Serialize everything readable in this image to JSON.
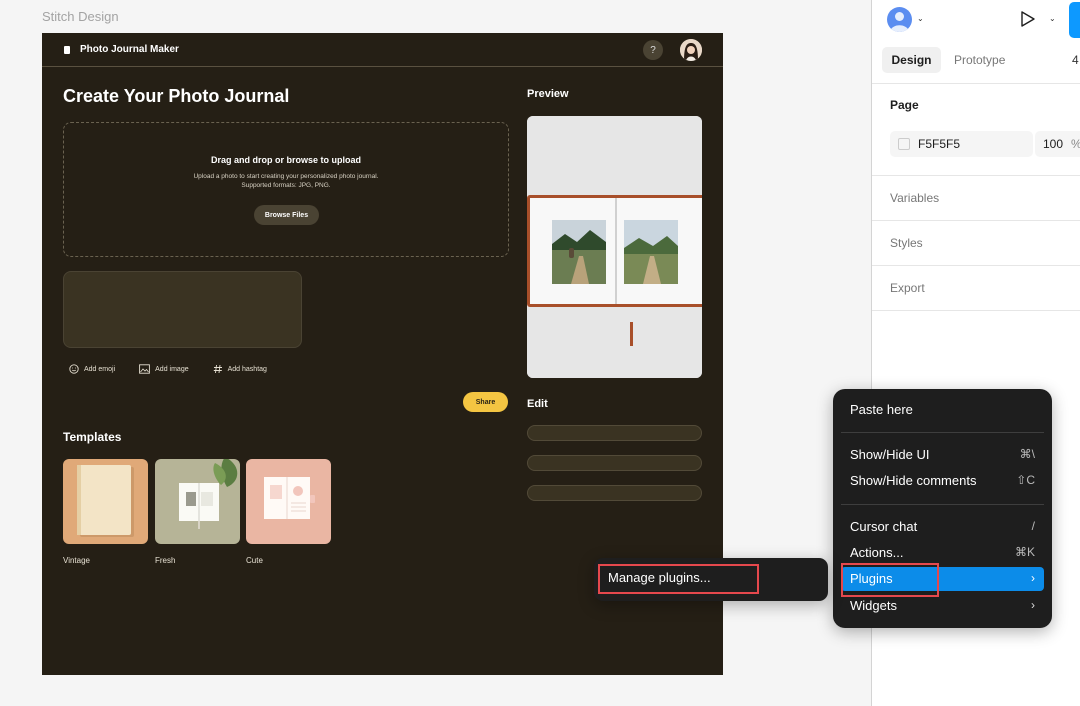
{
  "canvas": {
    "frame_label": "Stitch Design"
  },
  "app": {
    "title": "Photo Journal Maker",
    "help_icon_glyph": "?",
    "main_title": "Create Your Photo Journal",
    "upload": {
      "title": "Drag and drop or browse to upload",
      "description_line1": "Upload a photo to start creating your personalized photo journal.",
      "description_line2": "Supported formats: JPG, PNG.",
      "browse_label": "Browse Files"
    },
    "tools": [
      {
        "label": "Add emoji",
        "icon": "smiley-icon"
      },
      {
        "label": "Add image",
        "icon": "image-icon"
      },
      {
        "label": "Add hashtag",
        "icon": "hashtag-icon"
      }
    ],
    "share_label": "Share",
    "templates_title": "Templates",
    "templates": [
      {
        "name": "Vintage",
        "bg": "#e0a978"
      },
      {
        "name": "Fresh",
        "bg": "#b6b497"
      },
      {
        "name": "Cute",
        "bg": "#eab6a3"
      }
    ],
    "preview_title": "Preview",
    "edit_title": "Edit",
    "colors": {
      "frame_bg": "#251f15",
      "accent": "#f4c542",
      "field_bg": "#3a3322"
    }
  },
  "panel": {
    "tabs": {
      "design": "Design",
      "prototype": "Prototype"
    },
    "zoom_partial": "4",
    "page_label": "Page",
    "page_color_hex": "F5F5F5",
    "page_opacity": "100",
    "opacity_unit": "%",
    "sections": [
      "Variables",
      "Styles",
      "Export"
    ],
    "share_button_color": "#0d99ff"
  },
  "context_menu": {
    "items": [
      {
        "label": "Paste here",
        "shortcut": ""
      },
      {
        "label": "Show/Hide UI",
        "shortcut": "⌘\\"
      },
      {
        "label": "Show/Hide comments",
        "shortcut": "⇧C"
      },
      {
        "label": "Cursor chat",
        "shortcut": "/"
      },
      {
        "label": "Actions...",
        "shortcut": "⌘K"
      },
      {
        "label": "Plugins",
        "chevron": "›"
      },
      {
        "label": "Widgets",
        "chevron": "›"
      }
    ],
    "active_color": "#0c8ce9"
  },
  "submenu": {
    "items": [
      {
        "label": "Manage plugins..."
      }
    ]
  },
  "highlight_color": "#e5484d"
}
